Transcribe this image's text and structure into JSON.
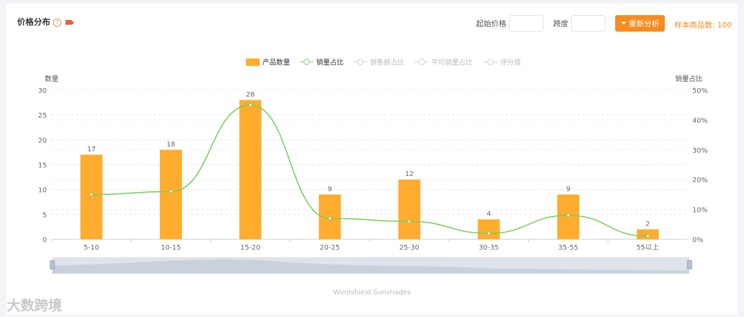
{
  "header": {
    "title": "价格分布",
    "help_icon": "?",
    "start_price_label": "起始价格",
    "span_label": "跨度",
    "reanalyze_label": "重新分析",
    "sample_count": "样本商品数: 100"
  },
  "watermark": "大数跨境",
  "chart_data": {
    "type": "bar+line",
    "categories": [
      "5-10",
      "10-15",
      "15-20",
      "20-25",
      "25-30",
      "30-35",
      "35-55",
      "55以上"
    ],
    "series": [
      {
        "name": "产品数量",
        "type": "bar",
        "axis": "left",
        "values": [
          17,
          18,
          28,
          9,
          12,
          4,
          9,
          2
        ],
        "color": "#ffac2f"
      },
      {
        "name": "销量占比",
        "type": "line",
        "axis": "right",
        "values": [
          15,
          16,
          45,
          7,
          6,
          2,
          8,
          1
        ],
        "color": "#7ccd5a"
      }
    ],
    "legend": [
      "产品数量",
      "销量占比",
      "销售额占比",
      "平均销量占比",
      "评分值"
    ],
    "legend_inactive": [
      "销售额占比",
      "平均销量占比",
      "评分值"
    ],
    "ylabel": "数量",
    "y2label": "销量占比",
    "ylim": [
      0,
      30
    ],
    "yticks": [
      "0",
      "5",
      "10",
      "15",
      "20",
      "25",
      "30"
    ],
    "y2lim": [
      0,
      50
    ],
    "y2ticks": [
      "0%",
      "10%",
      "20%",
      "30%",
      "40%",
      "50%"
    ],
    "xlabel": "Windshield Sunshades",
    "legend_position": "top-center",
    "grid": true
  }
}
